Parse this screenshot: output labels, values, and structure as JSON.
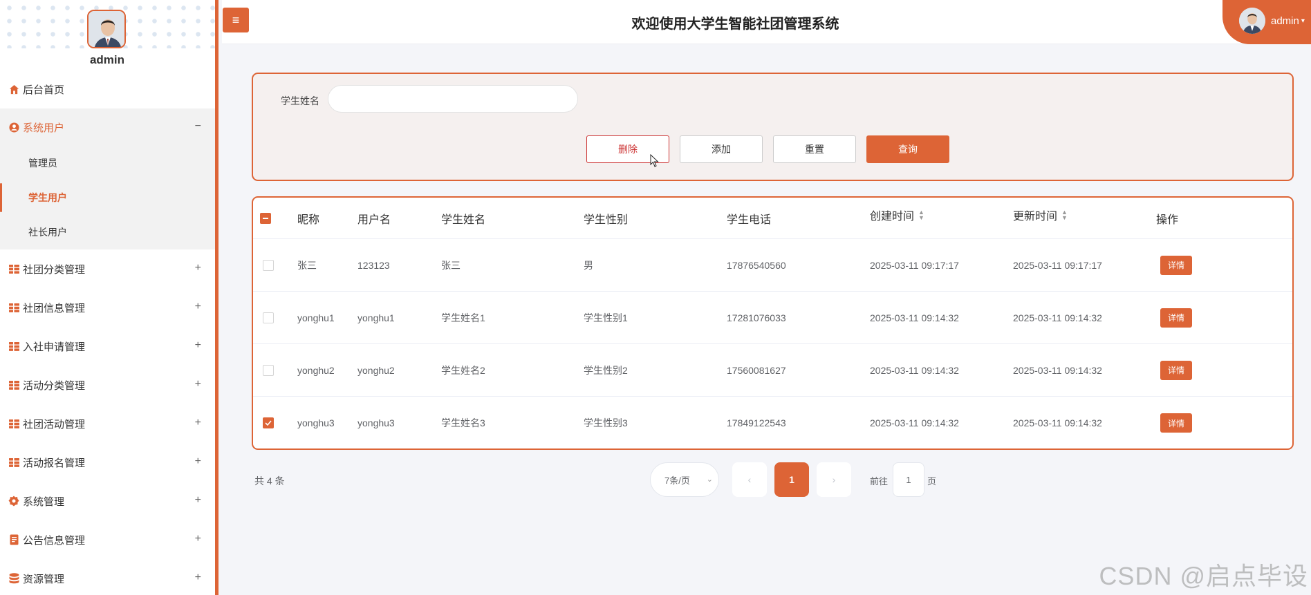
{
  "sidebar": {
    "admin_name": "admin",
    "home": "后台首页",
    "system_users": "系统用户",
    "system_users_toggle": "−",
    "sub_items": [
      "管理员",
      "学生用户",
      "社长用户"
    ],
    "menu_items": [
      "社团分类管理",
      "社团信息管理",
      "入社申请管理",
      "活动分类管理",
      "社团活动管理",
      "活动报名管理",
      "系统管理",
      "公告信息管理",
      "资源管理"
    ],
    "expand_symbol": "+"
  },
  "header": {
    "menu_button": "≡",
    "title": "欢迎使用大学生智能社团管理系统",
    "username": "admin"
  },
  "search": {
    "label": "学生姓名",
    "value": "",
    "delete_label": "删除",
    "add_label": "添加",
    "reset_label": "重置",
    "query_label": "查询"
  },
  "table": {
    "headers": [
      "昵称",
      "用户名",
      "学生姓名",
      "学生性别",
      "学生电话",
      "创建时间",
      "更新时间",
      "操作"
    ],
    "rows": [
      {
        "nickname": "张三",
        "username": "123123",
        "name": "张三",
        "gender": "男",
        "phone": "17876540560",
        "created": "2025-03-11 09:17:17",
        "updated": "2025-03-11 09:17:17",
        "action": "详情",
        "checked": false
      },
      {
        "nickname": "yonghu1",
        "username": "yonghu1",
        "name": "学生姓名1",
        "gender": "学生性别1",
        "phone": "17281076033",
        "created": "2025-03-11 09:14:32",
        "updated": "2025-03-11 09:14:32",
        "action": "详情",
        "checked": false
      },
      {
        "nickname": "yonghu2",
        "username": "yonghu2",
        "name": "学生姓名2",
        "gender": "学生性别2",
        "phone": "17560081627",
        "created": "2025-03-11 09:14:32",
        "updated": "2025-03-11 09:14:32",
        "action": "详情",
        "checked": false
      },
      {
        "nickname": "yonghu3",
        "username": "yonghu3",
        "name": "学生姓名3",
        "gender": "学生性别3",
        "phone": "17849122543",
        "created": "2025-03-11 09:14:32",
        "updated": "2025-03-11 09:14:32",
        "action": "详情",
        "checked": true
      }
    ]
  },
  "pagination": {
    "total": "共 4 条",
    "page_size": "7条/页",
    "current_page": "1",
    "goto_prefix": "前往",
    "goto_value": "1",
    "goto_suffix": "页"
  },
  "watermark": "CSDN @启点毕设",
  "colors": {
    "accent": "#dd6436",
    "delete": "#cc3333"
  }
}
